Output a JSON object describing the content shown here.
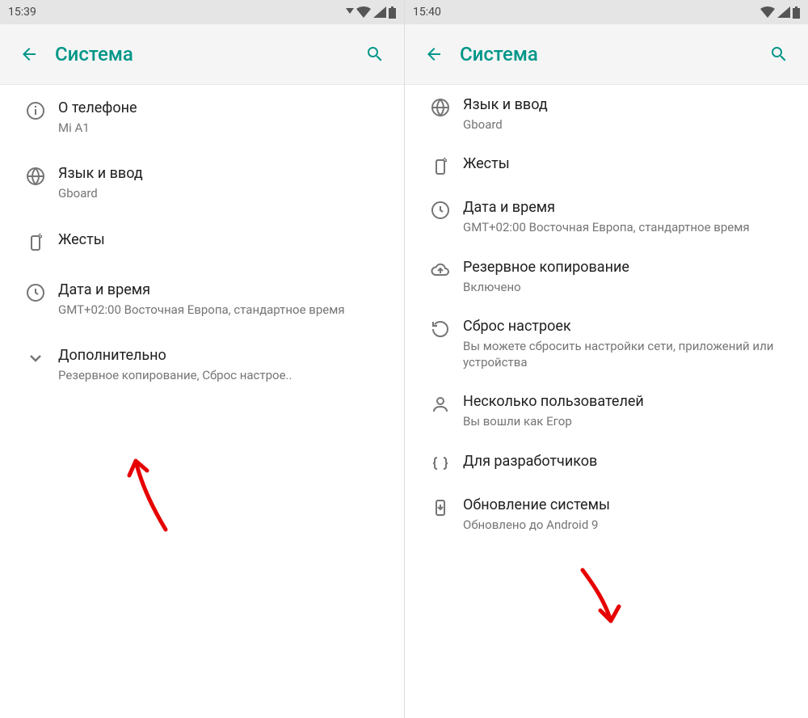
{
  "left": {
    "statusTime": "15:39",
    "title": "Система",
    "items": [
      {
        "icon": "info",
        "title": "О телефоне",
        "sub": "Mi A1"
      },
      {
        "icon": "globe",
        "title": "Язык и ввод",
        "sub": "Gboard"
      },
      {
        "icon": "gesture",
        "title": "Жесты",
        "sub": ""
      },
      {
        "icon": "clock",
        "title": "Дата и время",
        "sub": "GMT+02:00 Восточная Европа, стандартное время"
      },
      {
        "icon": "chevron",
        "title": "Дополнительно",
        "sub": "Резервное копирование, Сброс настрое.."
      }
    ]
  },
  "right": {
    "statusTime": "15:40",
    "title": "Система",
    "items": [
      {
        "icon": "globe",
        "title": "Язык и ввод",
        "sub": "Gboard"
      },
      {
        "icon": "gesture",
        "title": "Жесты",
        "sub": ""
      },
      {
        "icon": "clock",
        "title": "Дата и время",
        "sub": "GMT+02:00 Восточная Европа, стандартное время"
      },
      {
        "icon": "backup",
        "title": "Резервное копирование",
        "sub": "Включено"
      },
      {
        "icon": "reset",
        "title": "Сброс настроек",
        "sub": "Вы можете сбросить настройки сети, приложений или устройства"
      },
      {
        "icon": "users",
        "title": "Несколько пользователей",
        "sub": "Вы вошли как Егор"
      },
      {
        "icon": "braces",
        "title": "Для разработчиков",
        "sub": ""
      },
      {
        "icon": "update",
        "title": "Обновление системы",
        "sub": "Обновлено до Android 9"
      }
    ]
  }
}
